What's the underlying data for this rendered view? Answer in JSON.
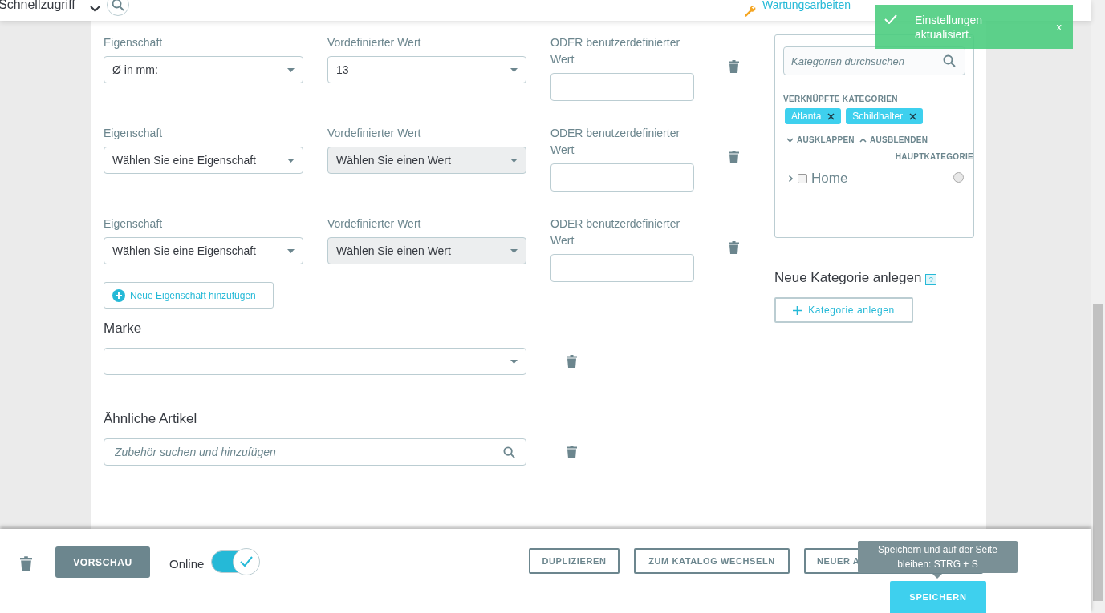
{
  "topbar": {
    "quick_access": "Schnellzugriff",
    "maintenance_link": "Wartungsarbeiten"
  },
  "toast": {
    "message": "Einstellungen aktualisiert.",
    "close": "x"
  },
  "features": [
    {
      "property_label": "Eigenschaft",
      "property": "Ø in mm:",
      "predefined_label": "Vordefinierter Wert",
      "predefined": {
        "value": "13",
        "disabled": false
      },
      "custom_label": "ODER benutzerdefinierter Wert"
    },
    {
      "property_label": "Eigenschaft",
      "property": "Wählen Sie eine Eigenschaft",
      "predefined_label": "Vordefinierter Wert",
      "predefined": {
        "value": "Wählen Sie einen Wert",
        "disabled": true
      },
      "custom_label": "ODER benutzerdefinierter Wert"
    },
    {
      "property_label": "Eigenschaft",
      "property": "Wählen Sie eine Eigenschaft",
      "predefined_label": "Vordefinierter Wert",
      "predefined": {
        "value": "Wählen Sie einen Wert",
        "disabled": true
      },
      "custom_label": "ODER benutzerdefinierter Wert"
    }
  ],
  "add_feature_button": "Neue Eigenschaft hinzufügen",
  "brand": {
    "label": "Marke"
  },
  "related": {
    "label": "Ähnliche Artikel",
    "placeholder": "Zubehör suchen und hinzufügen"
  },
  "categories": {
    "search_placeholder": "Kategorien durchsuchen",
    "linked_label": "VERKNÜPFTE KATEGORIEN",
    "tags": [
      "Atlanta",
      "Schildhalter"
    ],
    "expand": "AUSKLAPPEN",
    "collapse": "AUSBLENDEN",
    "main_category_label": "HAUPTKATEGORIE",
    "tree": [
      {
        "label": "Home",
        "checked": false,
        "main": false,
        "expanded": false
      }
    ]
  },
  "new_category": {
    "title": "Neue Kategorie anlegen",
    "help": "?",
    "button": "Kategorie anlegen"
  },
  "footer": {
    "preview": "VORSCHAU",
    "online_label": "Online",
    "online": true,
    "buttons": [
      "DUPLIZIEREN",
      "ZUM KATALOG WECHSELN",
      "NEUER A"
    ],
    "save": "SPEICHERN",
    "tooltip": "Speichern und auf der Seite bleiben: STRG + S"
  }
}
